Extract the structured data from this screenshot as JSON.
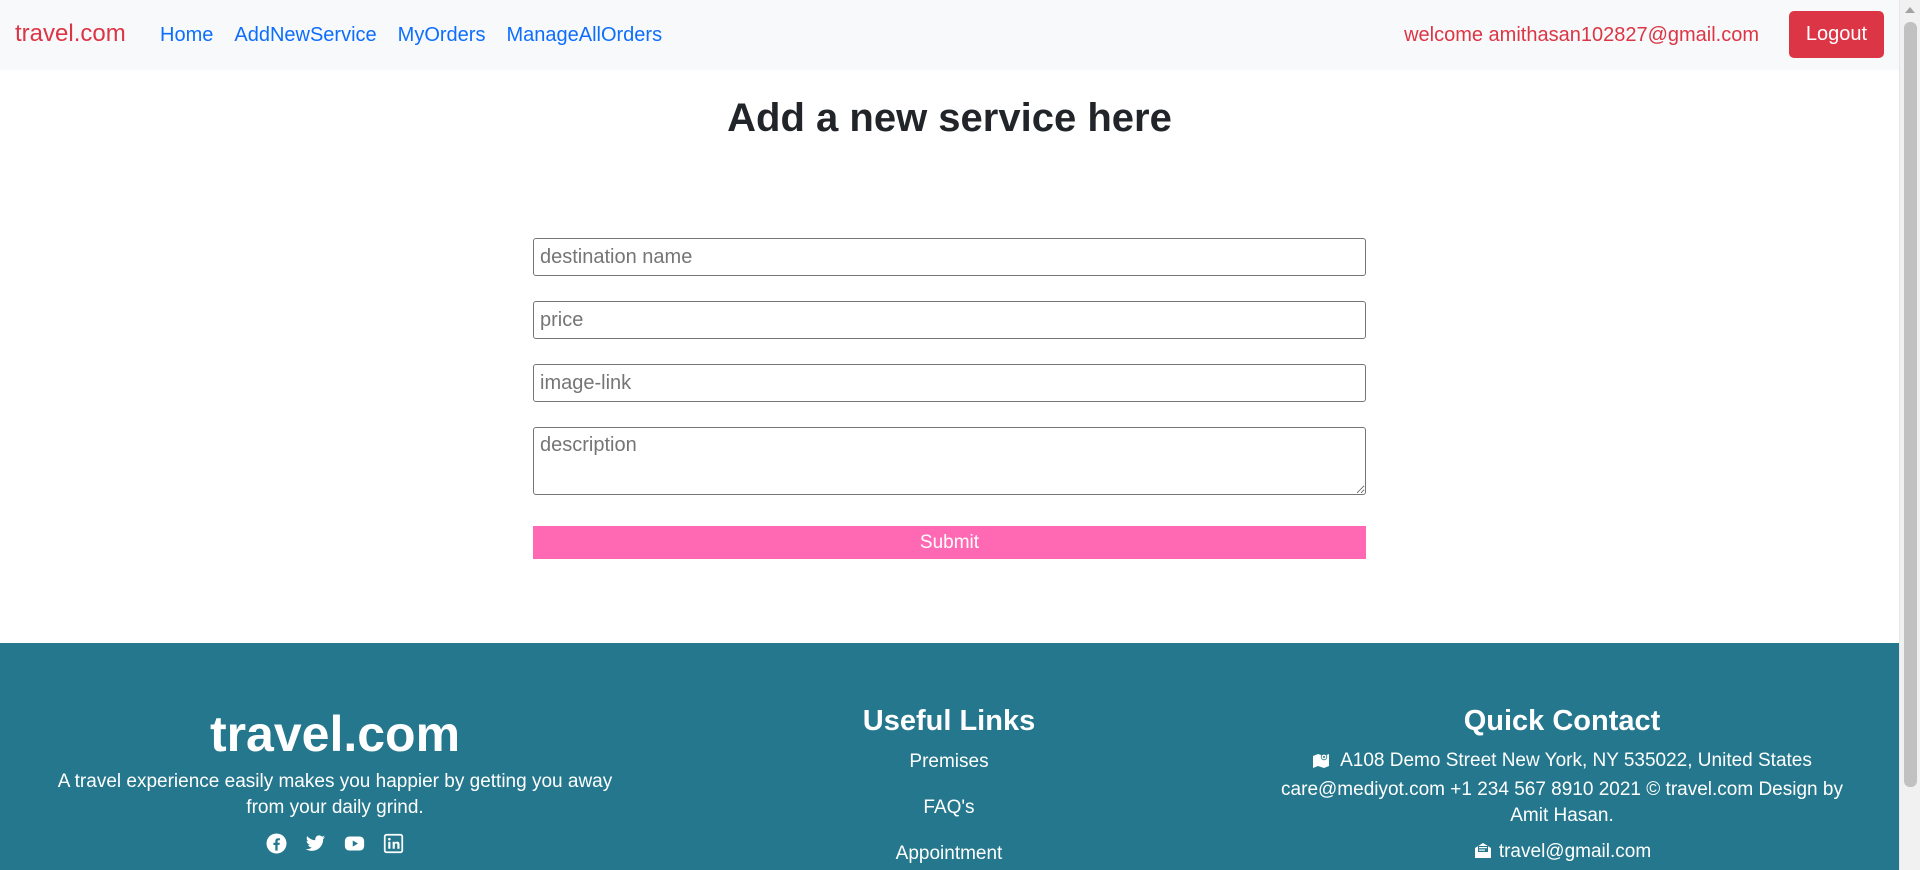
{
  "navbar": {
    "brand": "travel.com",
    "links": [
      "Home",
      "AddNewService",
      "MyOrders",
      "ManageAllOrders"
    ],
    "welcome": "welcome amithasan102827@gmail.com",
    "logout_label": "Logout"
  },
  "main": {
    "title": "Add a new service here",
    "form": {
      "destination_placeholder": "destination name",
      "price_placeholder": "price",
      "image_placeholder": "image-link",
      "description_placeholder": "description",
      "submit_label": "Submit"
    }
  },
  "footer": {
    "brand": "travel.com",
    "tagline": "A travel experience easily makes you happier by getting you away from your daily grind.",
    "socials": [
      "facebook-icon",
      "twitter-icon",
      "youtube-icon",
      "linkedin-icon"
    ],
    "useful_links": {
      "title": "Useful Links",
      "items": [
        "Premises",
        "FAQ's",
        "Appointment"
      ]
    },
    "quick_contact": {
      "title": "Quick Contact",
      "address": "A108 Demo Street New York, NY 535022, United States care@mediyot.com +1 234 567 8910 2021 © travel.com Design by Amit Hasan.",
      "email": "travel@gmail.com"
    }
  },
  "colors": {
    "brand_red": "#dc3545",
    "link_blue": "#0d6efd",
    "submit_pink": "#ff69b4",
    "footer_teal": "#24778d"
  }
}
